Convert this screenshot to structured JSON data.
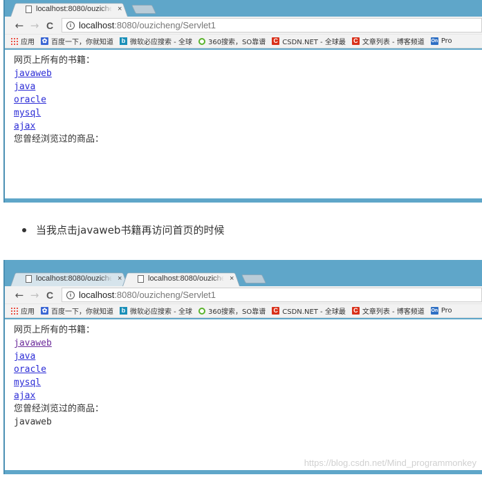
{
  "screenshot1": {
    "tabs": [
      {
        "title": "localhost:8080/ouziche",
        "close": "×",
        "active": true
      }
    ],
    "toolbar": {
      "back": "←",
      "forward": "→",
      "reload": "C",
      "info": "i",
      "url_host": "localhost",
      "url_path": ":8080/ouzicheng/Servlet1"
    },
    "bookmarks": [
      {
        "icon": "apps-icon",
        "label": "应用"
      },
      {
        "icon": "baidu-icon",
        "label": "百度一下，你就知道"
      },
      {
        "icon": "bing-icon",
        "label": "微软必应搜索 - 全球"
      },
      {
        "icon": "so-icon",
        "label": "360搜索，SO靠谱"
      },
      {
        "icon": "csdn-icon",
        "label": "CSDN.NET - 全球最"
      },
      {
        "icon": "csdn-icon",
        "label": "文章列表 - 博客频道"
      },
      {
        "icon": "on-icon",
        "label": "Pro"
      }
    ],
    "page": {
      "heading": "网页上所有的书籍：",
      "books": [
        "javaweb",
        "java",
        "oracle",
        "mysql",
        "ajax"
      ],
      "history_heading": "您曾经浏览过的商品：",
      "history": []
    }
  },
  "caption": "当我点击javaweb书籍再访问首页的时候",
  "screenshot2": {
    "tabs": [
      {
        "title": "localhost:8080/ouziche",
        "close": "×",
        "active": false
      },
      {
        "title": "localhost:8080/ouziche",
        "close": "×",
        "active": true
      }
    ],
    "toolbar": {
      "back": "←",
      "forward": "→",
      "reload": "C",
      "info": "i",
      "url_host": "localhost",
      "url_path": ":8080/ouzicheng/Servlet1"
    },
    "bookmarks": [
      {
        "icon": "apps-icon",
        "label": "应用"
      },
      {
        "icon": "baidu-icon",
        "label": "百度一下，你就知道"
      },
      {
        "icon": "bing-icon",
        "label": "微软必应搜索 - 全球"
      },
      {
        "icon": "so-icon",
        "label": "360搜索，SO靠谱"
      },
      {
        "icon": "csdn-icon",
        "label": "CSDN.NET - 全球最"
      },
      {
        "icon": "csdn-icon",
        "label": "文章列表 - 博客频道"
      },
      {
        "icon": "on-icon",
        "label": "Pro"
      }
    ],
    "page": {
      "heading": "网页上所有的书籍：",
      "books": [
        "javaweb",
        "java",
        "oracle",
        "mysql",
        "ajax"
      ],
      "visited_book": "javaweb",
      "history_heading": "您曾经浏览过的商品：",
      "history": [
        "javaweb"
      ]
    }
  },
  "bookmark_icon_glyphs": {
    "apps-icon": "",
    "baidu-icon": "✿",
    "bing-icon": "b",
    "so-icon": "",
    "csdn-icon": "C",
    "on-icon": "On"
  },
  "watermark": "https://blog.csdn.net/Mind_programmonkey"
}
